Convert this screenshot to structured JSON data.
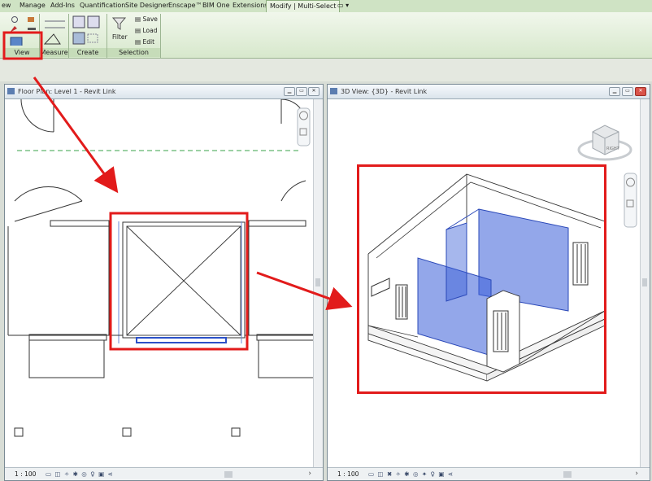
{
  "ribbon": {
    "tabs": [
      "ew",
      "Manage",
      "Add-Ins",
      "Quantification",
      "Site Designer",
      "Enscape™",
      "BIM One",
      "Extensions",
      "Modify | Multi-Select"
    ],
    "active_tab": "Modify | Multi-Select",
    "panels": [
      "View",
      "Measure",
      "Create",
      "Selection"
    ],
    "buttons": {
      "filter": "Filter",
      "save": "Save",
      "load": "Load",
      "edit": "Edit"
    }
  },
  "views": {
    "left": {
      "title": "Floor Plan: Level 1 - Revit Link",
      "scale": "1 : 100"
    },
    "right": {
      "title": "3D View: {3D} - Revit Link",
      "scale": "1 : 100",
      "viewcube_face": "RIGHT"
    }
  },
  "colors": {
    "annotation_red": "#e21b1b",
    "wall_blue": "#3a5fd8",
    "ribbon_green": "#d7e8cc"
  }
}
